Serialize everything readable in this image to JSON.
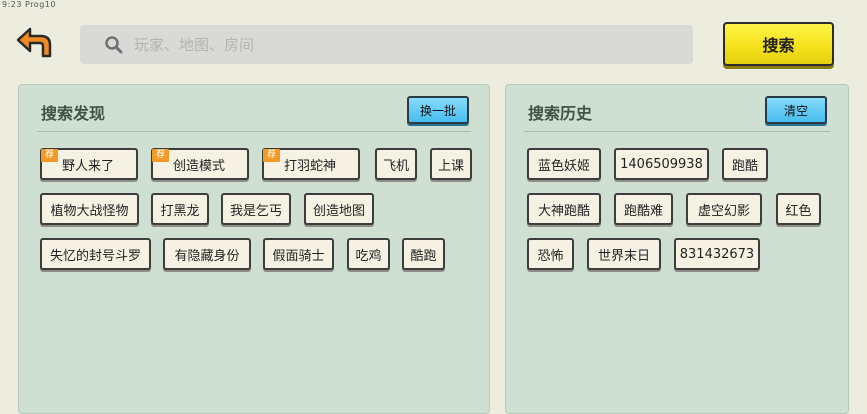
{
  "status_text": "9:23 Prog10",
  "back_icon": "back-arrow-icon",
  "search": {
    "placeholder": "玩家、地图、房间",
    "value": "",
    "button_label": "搜索",
    "button_color": "#f5e21b"
  },
  "discover": {
    "title": "搜索发现",
    "refresh_label": "换一批",
    "recommend_badge": "荐",
    "tags": [
      "野人来了",
      "创造模式",
      "打羽蛇神",
      "飞机",
      "上课",
      "植物大战怪物",
      "打黑龙",
      "我是乞丐",
      "创造地图",
      "失忆的封号斗罗",
      "有隐藏身份",
      "假面骑士",
      "吃鸡",
      "酷跑"
    ]
  },
  "history": {
    "title": "搜索历史",
    "clear_label": "清空",
    "tags": [
      "蓝色妖姬",
      "1406509938",
      "跑酷",
      "大神跑酷",
      "跑酷难",
      "虚空幻影",
      "红色",
      "恐怖",
      "世界末日",
      "831432673"
    ]
  },
  "colors": {
    "background": "#ececdf",
    "panel": "#cfe0d2",
    "accent_blue": "#46bcef",
    "badge_orange": "#f19a27",
    "back_orange": "#f08a23"
  }
}
